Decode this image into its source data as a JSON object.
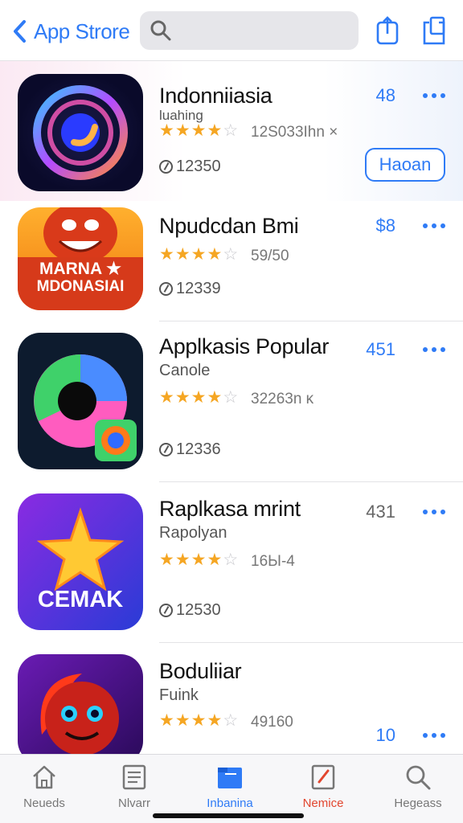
{
  "header": {
    "back_label": "App Strore",
    "search_placeholder": "",
    "icons": [
      "search-icon",
      "share-icon",
      "tray-icon"
    ]
  },
  "apps": [
    {
      "name": "Indonniiasia",
      "subtitle": "luahing",
      "stars": 4,
      "rating_count": "12S033Ihn ×",
      "downloads": "12350",
      "price": "48",
      "button": "Haoan"
    },
    {
      "name": "Npudcdan Bmi",
      "subtitle": "",
      "stars": 4,
      "rating_count": "59/50",
      "downloads": "12339",
      "price": "$8",
      "icon_text_1": "MARNA ★",
      "icon_text_2": "MDONASIAI"
    },
    {
      "name": "Applkasis Popular",
      "subtitle": "Canole",
      "stars": 4,
      "rating_count": "32263n ĸ",
      "downloads": "12336",
      "price": "451"
    },
    {
      "name": "Raplkasa mrint",
      "subtitle": "Rapolyan",
      "stars": 4,
      "rating_count": "16Ы-4",
      "downloads": "12530",
      "price": "431",
      "icon_text_1": "CEMAK"
    },
    {
      "name": "Boduliiar",
      "subtitle": "Fuink",
      "stars": 4,
      "rating_count": "49160",
      "price": "10"
    }
  ],
  "tabs": [
    {
      "label": "Neueds",
      "icon": "house-icon"
    },
    {
      "label": "Nlvarr",
      "icon": "list-icon"
    },
    {
      "label": "Inbanina",
      "icon": "folder-icon"
    },
    {
      "label": "Nemice",
      "icon": "edit-icon"
    },
    {
      "label": "Hegeass",
      "icon": "search-icon"
    }
  ],
  "colors": {
    "accent": "#2f7bf6",
    "star": "#f5a623",
    "red_tab": "#e2462f"
  }
}
